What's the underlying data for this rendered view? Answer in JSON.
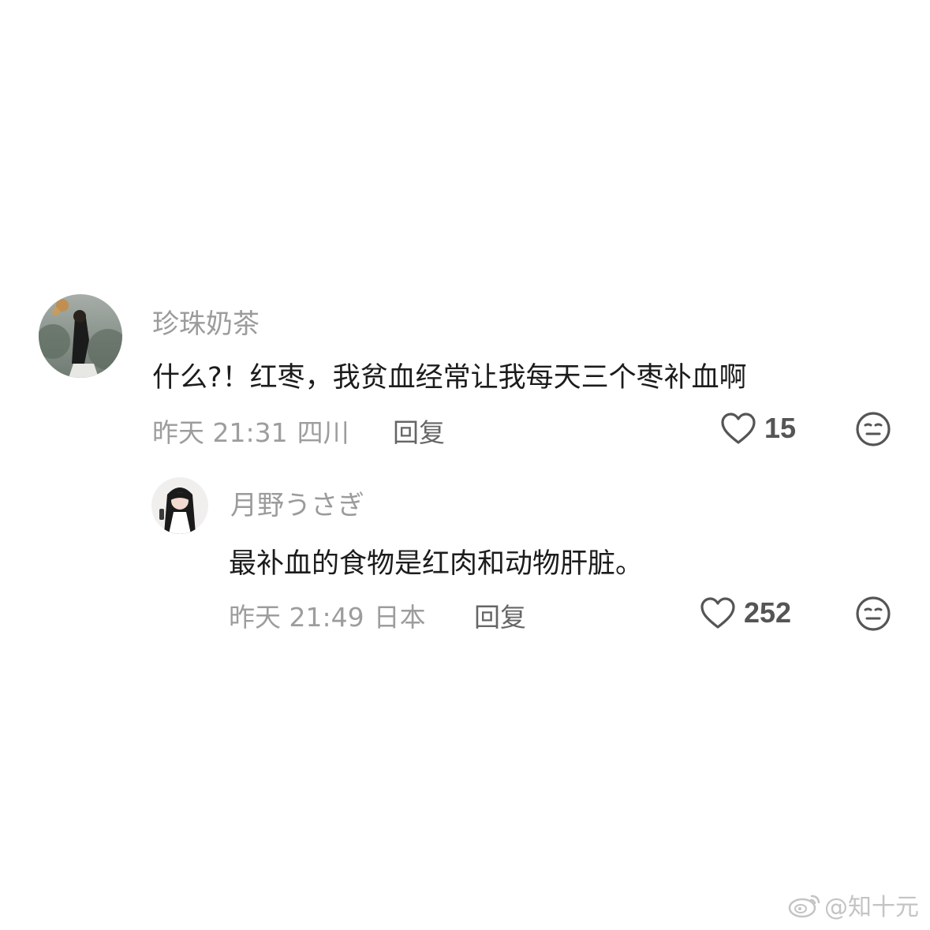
{
  "comments": [
    {
      "username": "珍珠奶茶",
      "text": "什么?！红枣，我贫血经常让我每天三个枣补血啊",
      "time": "昨天 21:31",
      "location": "四川",
      "reply_label": "回复",
      "likes": "15",
      "avatar_icon": "avatar-photo-icon",
      "like_icon": "heart-outline-icon",
      "emoji_icon": "meh-face-icon"
    },
    {
      "username": "月野うさぎ",
      "text": "最补血的食物是红肉和动物肝脏。",
      "time": "昨天 21:49",
      "location": "日本",
      "reply_label": "回复",
      "likes": "252",
      "avatar_icon": "avatar-photo-icon",
      "like_icon": "heart-outline-icon",
      "emoji_icon": "meh-face-icon"
    }
  ],
  "watermark": {
    "text": "@知十元",
    "icon": "weibo-logo-icon"
  },
  "colors": {
    "username": "#9b9b9b",
    "body_text": "#1c1c1c",
    "meta": "#9d9d9d",
    "reply": "#666666",
    "icons": "#555555"
  }
}
